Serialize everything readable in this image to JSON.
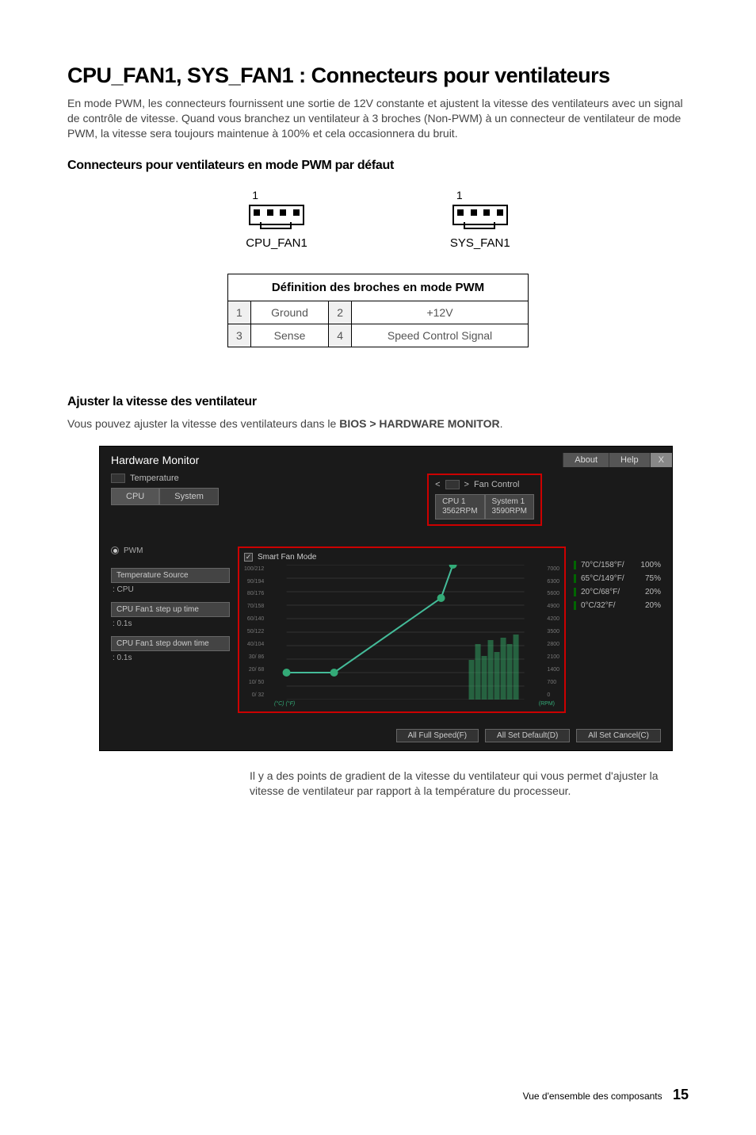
{
  "title": "CPU_FAN1, SYS_FAN1 : Connecteurs pour ventilateurs",
  "intro": "En mode PWM, les connecteurs fournissent une sortie de 12V constante et ajustent la vitesse des ventilateurs avec un signal de contrôle de vitesse. Quand vous branchez un ventilateur à 3 broches (Non-PWM) à un connecteur de ventilateur de mode PWM, la vitesse sera toujours maintenue à 100% et cela occasionnera du bruit.",
  "h2_default": "Connecteurs pour ventilateurs en mode PWM par défaut",
  "pin1_marker": "1",
  "conn_cpu": "CPU_FAN1",
  "conn_sys": "SYS_FAN1",
  "table_header": "Définition des broches en mode PWM",
  "pins": [
    {
      "n": "1",
      "name": "Ground"
    },
    {
      "n": "2",
      "name": "+12V"
    },
    {
      "n": "3",
      "name": "Sense"
    },
    {
      "n": "4",
      "name": "Speed Control Signal"
    }
  ],
  "h2_adjust": "Ajuster la vitesse des ventilateur",
  "adjust_text_pre": "Vous pouvez ajuster la vitesse des ventilateurs dans le ",
  "adjust_text_bold": "BIOS > HARDWARE MONITOR",
  "bios": {
    "title": "Hardware Monitor",
    "about": "About",
    "help": "Help",
    "x": "X",
    "temperature": "Temperature",
    "cpu_tab": "CPU",
    "system_tab": "System",
    "fan_control": "Fan Control",
    "cpu1_tab": "CPU 1\n3562RPM",
    "sys1_tab": "System 1\n3590RPM",
    "pwm": "PWM",
    "temp_src": "Temperature Source",
    "temp_src_val": ": CPU",
    "step_up": "CPU Fan1 step up time",
    "step_up_val": ": 0.1s",
    "step_down": "CPU Fan1 step down time",
    "step_down_val": ": 0.1s",
    "smart_fan": "Smart Fan Mode",
    "y_left": [
      "100/212",
      "90/194",
      "80/176",
      "70/158",
      "60/140",
      "50/122",
      "40/104",
      "30/ 86",
      "20/ 68",
      "10/ 50",
      "0/ 32"
    ],
    "y_right": [
      "7000",
      "6300",
      "5600",
      "4900",
      "4200",
      "3500",
      "2800",
      "2100",
      "1400",
      "700",
      "0"
    ],
    "x_left": "(°C) (°F)",
    "x_right": "(RPM)",
    "right_rows": [
      {
        "t": "70°C/158°F/",
        "p": "100%"
      },
      {
        "t": "65°C/149°F/",
        "p": "75%"
      },
      {
        "t": "20°C/68°F/",
        "p": "20%"
      },
      {
        "t": "0°C/32°F/",
        "p": "20%"
      }
    ],
    "full_speed": "All Full Speed(F)",
    "set_default": "All Set Default(D)",
    "set_cancel": "All Set Cancel(C)"
  },
  "chart_data": {
    "type": "line",
    "title": "Smart Fan Mode",
    "xlabel": "(°C) (°F)",
    "ylabel_right": "(RPM)",
    "y_left_ticks_c": [
      0,
      10,
      20,
      30,
      40,
      50,
      60,
      70,
      80,
      90,
      100
    ],
    "y_left_ticks_f": [
      32,
      50,
      68,
      86,
      104,
      122,
      140,
      158,
      176,
      194,
      212
    ],
    "y_right_ticks_rpm": [
      0,
      700,
      1400,
      2100,
      2800,
      3500,
      4200,
      4900,
      5600,
      6300,
      7000
    ],
    "control_points": [
      {
        "c": 0,
        "duty_pct": 20
      },
      {
        "c": 20,
        "duty_pct": 20
      },
      {
        "c": 65,
        "duty_pct": 75
      },
      {
        "c": 70,
        "duty_pct": 100
      }
    ],
    "fan_bar_rpm_approx": [
      2100,
      2800,
      2400,
      3000,
      2600,
      3100,
      2800,
      3200
    ]
  },
  "caption": "Il y a des points de gradient de la vitesse du ventilateur qui vous permet d'ajuster la vitesse de ventilateur par rapport à la température du processeur.",
  "footer_text": "Vue d'ensemble des composants",
  "footer_page": "15"
}
